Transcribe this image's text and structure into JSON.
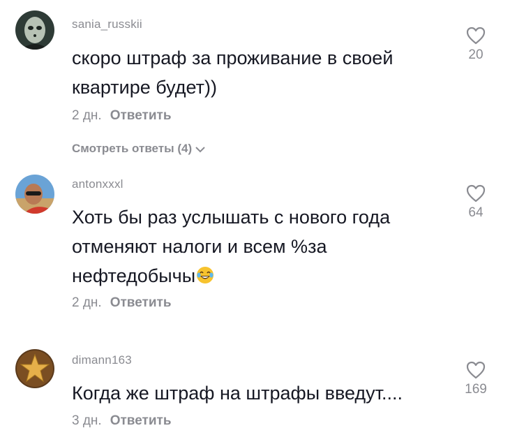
{
  "comments": [
    {
      "username": "sania_russkii",
      "text_lines": [
        "скоро штраф за проживание в своей",
        "квартире будет))"
      ],
      "time": "2 дн.",
      "reply_label": "Ответить",
      "likes": "20",
      "view_replies": "Смотреть ответы (4)"
    },
    {
      "username": "antonxxxl",
      "text_lines": [
        "Хоть бы раз услышать с нового года",
        "отменяют налоги и всем %за",
        "нефтедобычы"
      ],
      "time": "2 дн.",
      "reply_label": "Ответить",
      "likes": "64",
      "emoji": "face-with-tears-of-joy"
    },
    {
      "username": "dimann163",
      "text_lines": [
        "Когда же штраф на штрафы введут...."
      ],
      "time": "3 дн.",
      "reply_label": "Ответить",
      "likes": "169"
    }
  ],
  "colors": {
    "text": "#161823",
    "secondary": "#8a8b91",
    "background": "#ffffff"
  }
}
